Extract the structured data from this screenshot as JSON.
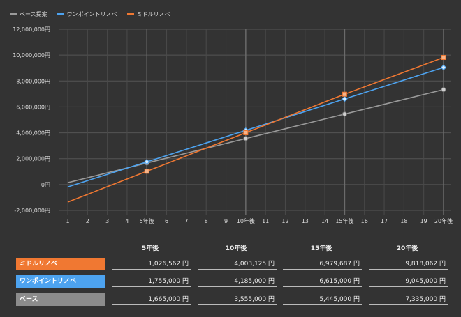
{
  "legend": [
    {
      "label": "ベース提案",
      "color": "#9a9a9a"
    },
    {
      "label": "ワンポイントリノベ",
      "color": "#4da3f0"
    },
    {
      "label": "ミドルリノベ",
      "color": "#f07832"
    }
  ],
  "chart_data": {
    "type": "line",
    "ylim": [
      -2000000,
      12000000
    ],
    "y_ticks": [
      "12,000,000円",
      "10,000,000円",
      "8,000,000円",
      "6,000,000円",
      "4,000,000円",
      "2,000,000円",
      "0円",
      "-2,000,000円"
    ],
    "y_tick_values": [
      12000000,
      10000000,
      8000000,
      6000000,
      4000000,
      2000000,
      0,
      -2000000
    ],
    "categories": [
      "1",
      "2",
      "3",
      "4",
      "5年後",
      "6",
      "7",
      "8",
      "9",
      "10年後",
      "11",
      "12",
      "13",
      "14",
      "15年後",
      "16",
      "17",
      "18",
      "19",
      "20年後"
    ],
    "series": [
      {
        "name": "ベース提案",
        "color": "#9a9a9a",
        "marker": "circle",
        "values": [
          143000,
          523500,
          904000,
          1284500,
          1665000,
          2043000,
          2421000,
          2799000,
          3177000,
          3555000,
          3933000,
          4311000,
          4689000,
          5067000,
          5445000,
          5823000,
          6201000,
          6579000,
          6957000,
          7335000
        ]
      },
      {
        "name": "ワンポイントリノベ",
        "color": "#4da3f0",
        "marker": "diamond",
        "values": [
          -181000,
          303000,
          787000,
          1271000,
          1755000,
          2241000,
          2727000,
          3213000,
          3699000,
          4185000,
          4671000,
          5157000,
          5643000,
          6129000,
          6615000,
          7101000,
          7587000,
          8073000,
          8559000,
          9045000
        ]
      },
      {
        "name": "ミドルリノベ",
        "color": "#f07832",
        "marker": "square",
        "values": [
          -1354550,
          -759120,
          -163690,
          431740,
          1026562,
          1621875,
          2217188,
          2812500,
          3407812,
          4003125,
          4598437,
          5193750,
          5789062,
          6384375,
          6979687,
          7547362,
          8115037,
          8682712,
          9250387,
          9818062
        ]
      }
    ],
    "marker_indices": [
      4,
      9,
      14,
      19
    ]
  },
  "table": {
    "headers": [
      "5年後",
      "10年後",
      "15年後",
      "20年後"
    ],
    "rows": [
      {
        "label": "ミドルリノベ",
        "color": "#f07832",
        "values": [
          "1,026,562 円",
          "4,003,125 円",
          "6,979,687 円",
          "9,818,062 円"
        ]
      },
      {
        "label": "ワンポイントリノベ",
        "color": "#4da3f0",
        "values": [
          "1,755,000 円",
          "4,185,000 円",
          "6,615,000 円",
          "9,045,000 円"
        ]
      },
      {
        "label": "ベース",
        "color": "#8c8c8c",
        "values": [
          "1,665,000 円",
          "3,555,000 円",
          "5,445,000 円",
          "7,335,000 円"
        ]
      }
    ]
  }
}
